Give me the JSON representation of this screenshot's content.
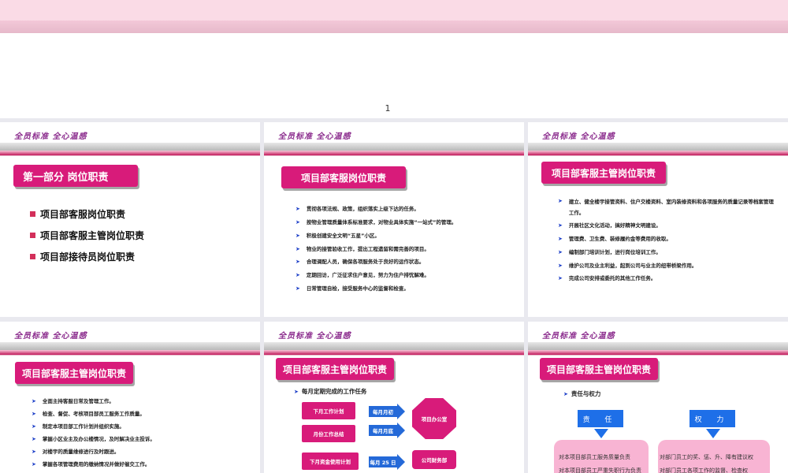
{
  "page_number": "1",
  "slogan": "全员标准 全心温感",
  "slides": {
    "s1": {
      "title": "第一部分 岗位职责",
      "items": [
        "项目部客服岗位职责",
        "项目部客服主管岗位职责",
        "项目部接待员岗位职责"
      ]
    },
    "s2": {
      "title": "项目部客服岗位职责",
      "items": [
        "贯彻各项法规、政策，组织落实上级下达的任务。",
        "按物业管理质量体系标准要求，对物业具体实施“一站式”的管理。",
        "积极创建安全文明“五星”小区。",
        "物业的接管验收工作，提出工程遗留和需完善的项目。",
        "合理调配人员，确保各项服务处于良好的运作状态。",
        "定期回访，广泛征求住户意见，努力为住户排忧解难。",
        "日常管理自检，接受服务中心的监督和检查。"
      ]
    },
    "s3": {
      "title": "项目部客服主管岗位职责",
      "items": [
        "建立、健全楼宇接管资料、住户交楼资料、室内装修资料和各项服务的质量记录等档案管理工作。",
        "开展社区文化活动，搞好精神文明建设。",
        "管理费、卫生费、装修履约金等费用的收取。",
        "编制部门培训计划，进行岗位培训工作。",
        "维护公司及业主利益，起到公司与业主的纽带桥梁作用。",
        "完成公司安排或委托的其他工作任务。"
      ]
    },
    "s4": {
      "title": "项目部客服主管岗位职责",
      "items": [
        "全面主持客服日常及管理工作。",
        "检查、督促、考核项目部员工服务工作质量。",
        "制定本项目部工作计划并组织实施。",
        "掌握小区业主及办公楼情况，及时解决业主投诉。",
        "对楼宇的质量维修进行及时跟进。",
        "掌握各项管理费用的缴纳情况并做好催交工作。"
      ]
    },
    "s5": {
      "title": "项目部客服主管岗位职责",
      "subtitle": "每月定期完成的工作任务",
      "boxes": [
        "下月工作计划",
        "月份工作总结",
        "下月资金使用计划"
      ],
      "arrows": [
        "每月月初",
        "每月月底",
        "每月 25 日"
      ],
      "targets": [
        "项目办公室",
        "公司财务部"
      ]
    },
    "s6": {
      "title": "项目部客服主管岗位职责",
      "subtitle": "责任与权力",
      "left_tag": "责 任",
      "right_tag": "权 力",
      "left_lines": [
        "对本项目部员工服务质量负责",
        "对本项目部员工严重失职行为负责"
      ],
      "right_lines": [
        "对部门员工的奖、惩、升、降有建议权",
        "对部门员工各项工作的监督、检查权"
      ]
    }
  }
}
